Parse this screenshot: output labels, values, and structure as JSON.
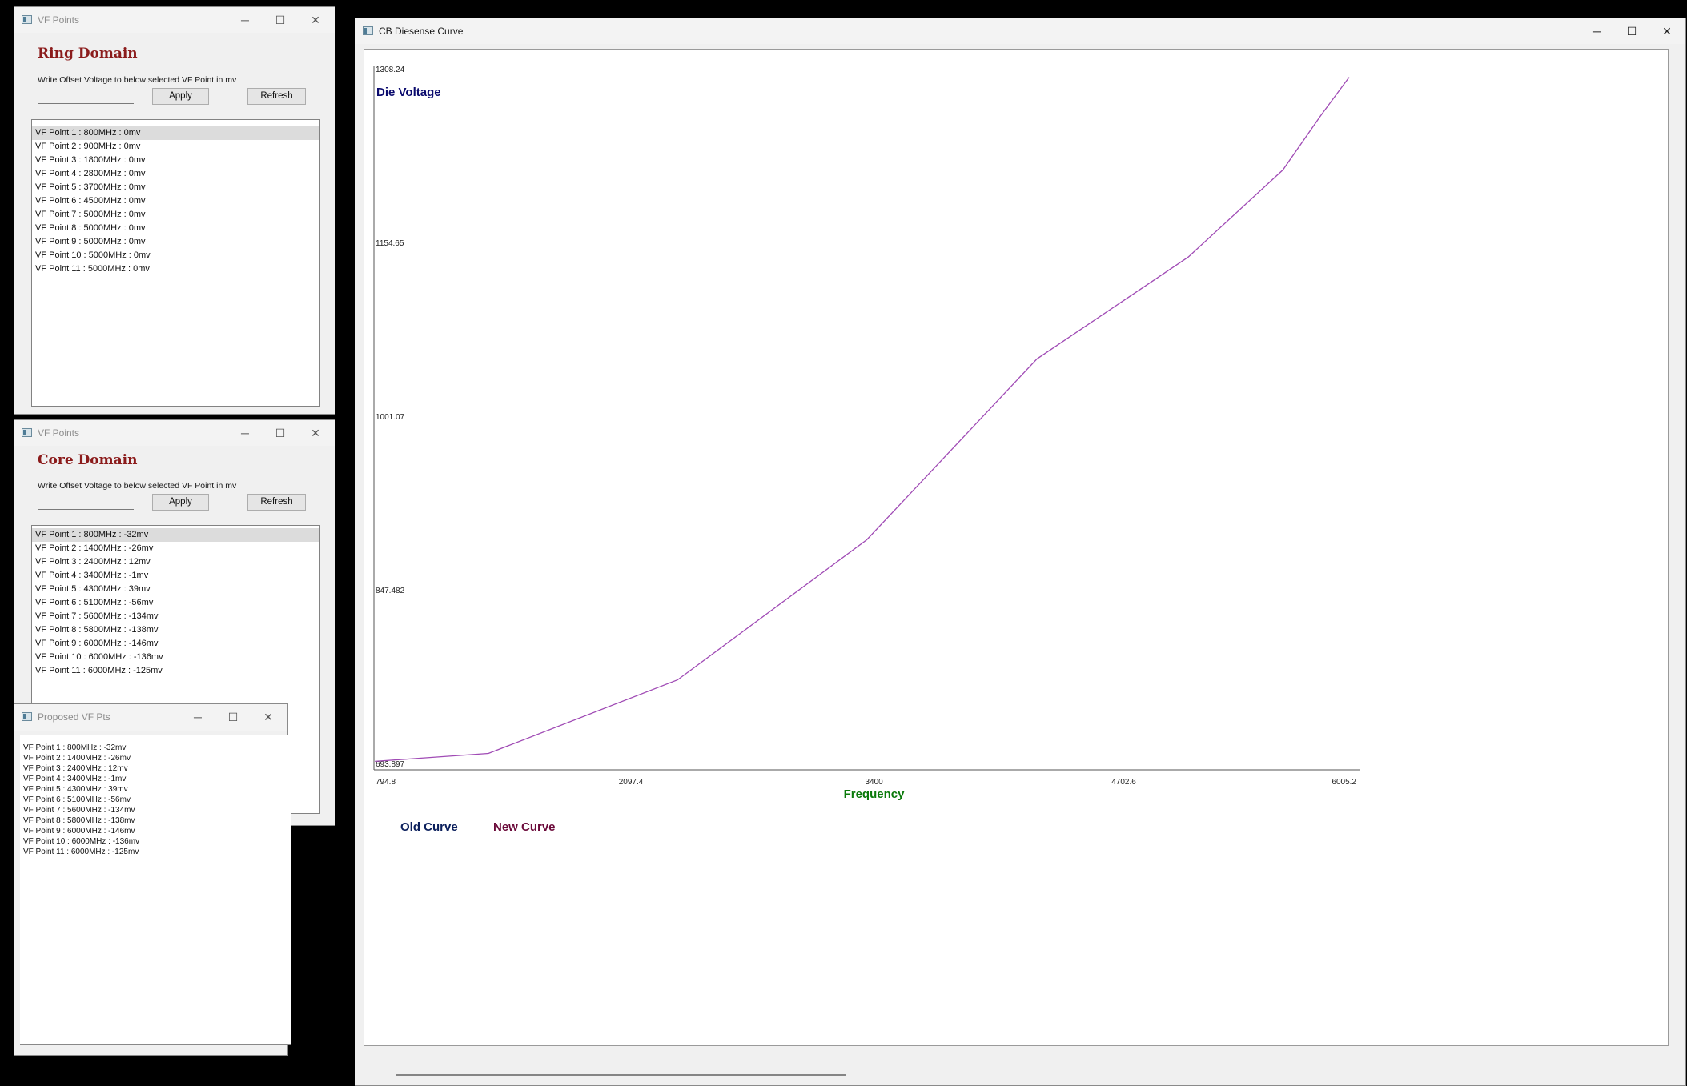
{
  "ring_window": {
    "title": "VF Points",
    "domain_title": "Ring Domain",
    "hint": "Write Offset Voltage to below selected VF Point in mv",
    "input_value": "",
    "apply_label": "Apply",
    "refresh_label": "Refresh",
    "items": [
      "VF Point 1 : 800MHz : 0mv",
      "VF Point 2 : 900MHz : 0mv",
      "VF Point 3 : 1800MHz : 0mv",
      "VF Point 4 : 2800MHz : 0mv",
      "VF Point 5 : 3700MHz : 0mv",
      "VF Point 6 : 4500MHz : 0mv",
      "VF Point 7 : 5000MHz : 0mv",
      "VF Point 8 : 5000MHz : 0mv",
      "VF Point 9 : 5000MHz : 0mv",
      "VF Point 10 : 5000MHz : 0mv",
      "VF Point 11 : 5000MHz : 0mv"
    ]
  },
  "core_window": {
    "title": "VF Points",
    "domain_title": "Core Domain",
    "hint": "Write Offset Voltage to below selected VF Point in mv",
    "input_value": "",
    "apply_label": "Apply",
    "refresh_label": "Refresh",
    "items": [
      "VF Point 1 : 800MHz : -32mv",
      "VF Point 2 : 1400MHz : -26mv",
      "VF Point 3 : 2400MHz : 12mv",
      "VF Point 4 : 3400MHz : -1mv",
      "VF Point 5 : 4300MHz : 39mv",
      "VF Point 6 : 5100MHz : -56mv",
      "VF Point 7 : 5600MHz : -134mv",
      "VF Point 8 : 5800MHz : -138mv",
      "VF Point 9 : 6000MHz : -146mv",
      "VF Point 10 : 6000MHz : -136mv",
      "VF Point 11 : 6000MHz : -125mv"
    ]
  },
  "proposed_window": {
    "title": "Proposed VF Pts",
    "items": [
      "VF Point 1 : 800MHz : -32mv",
      "VF Point 2 : 1400MHz : -26mv",
      "VF Point 3 : 2400MHz : 12mv",
      "VF Point 4 : 3400MHz : -1mv",
      "VF Point 5 : 4300MHz : 39mv",
      "VF Point 6 : 5100MHz : -56mv",
      "VF Point 7 : 5600MHz : -134mv",
      "VF Point 8 : 5800MHz : -138mv",
      "VF Point 9 : 6000MHz : -146mv",
      "VF Point 10 : 6000MHz : -136mv",
      "VF Point 11 : 6000MHz : -125mv"
    ]
  },
  "chart_window": {
    "title": "CB Diesense Curve"
  },
  "window_controls": {
    "minimize": "─",
    "maximize": "☐",
    "close": "✕"
  },
  "colors": {
    "domain_title": "#8b1b1b",
    "y_label": "#0b0b6e",
    "x_label": "#0a7a0a",
    "old_curve": "#0b1f5c",
    "new_curve": "#a04bb5",
    "new_curve_legend": "#6b0a3a"
  },
  "chart_data": {
    "type": "line",
    "title": "",
    "ylabel": "Die Voltage",
    "xlabel": "Frequency",
    "xlim": [
      794.8,
      6005.2
    ],
    "ylim": [
      693.897,
      1308.24
    ],
    "x_ticks": [
      "794.8",
      "2097.4",
      "3400",
      "4702.6",
      "6005.2"
    ],
    "y_ticks": [
      "693.897",
      "847.482",
      "1001.07",
      "1154.65",
      "1308.24"
    ],
    "legend": [
      "Old Curve",
      "New Curve"
    ],
    "legend_position": "bottom-left",
    "series": [
      {
        "name": "New Curve",
        "x": [
          800,
          1400,
          2400,
          3400,
          4300,
          5100,
          5600,
          5800,
          5950
        ],
        "y": [
          700,
          707,
          772,
          896,
          1056,
          1146,
          1223,
          1271,
          1305
        ]
      }
    ]
  }
}
